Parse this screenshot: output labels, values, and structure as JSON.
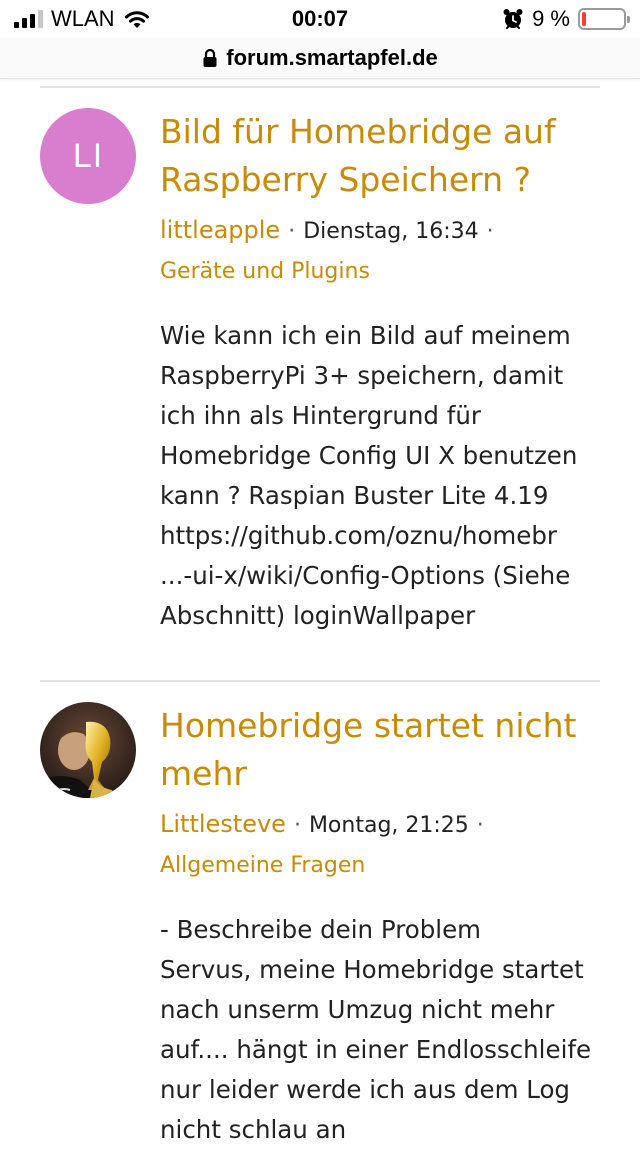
{
  "status_bar": {
    "carrier": "WLAN",
    "time": "00:07",
    "battery_percent": "9 %",
    "battery_level": 0.09,
    "battery_color": "#ff3b30"
  },
  "browser": {
    "url": "forum.smartapfel.de"
  },
  "colors": {
    "accent": "#c98a05",
    "avatar_bg": "#d97dce"
  },
  "posts": [
    {
      "avatar_initials": "LI",
      "title": "Bild für Homebridge auf Raspberry Speichern ?",
      "author": "littleapple",
      "date": "Dienstag, 16:34",
      "category": "Geräte und Plugins",
      "excerpt": "Wie kann ich ein Bild auf meinem RaspberryPi 3+ speichern, damit ich ihn als Hintergrund für Homebridge Config UI X benutzen kann ? Raspian Buster Lite 4.19\nhttps://github.com/oznu/homebr\n...-ui-x/wiki/Config-Options (Siehe Abschnitt) loginWallpaper"
    },
    {
      "avatar_icon": "user-photo-avatar",
      "title": "Homebridge startet nicht mehr",
      "author": "Littlesteve",
      "date": "Montag, 21:25",
      "category": "Allgemeine Fragen",
      "excerpt": "- Beschreibe dein Problem\nServus, meine Homebridge startet nach unserm Umzug nicht mehr auf.... hängt in einer Endlosschleife nur leider werde ich aus dem Log nicht schlau an"
    }
  ]
}
